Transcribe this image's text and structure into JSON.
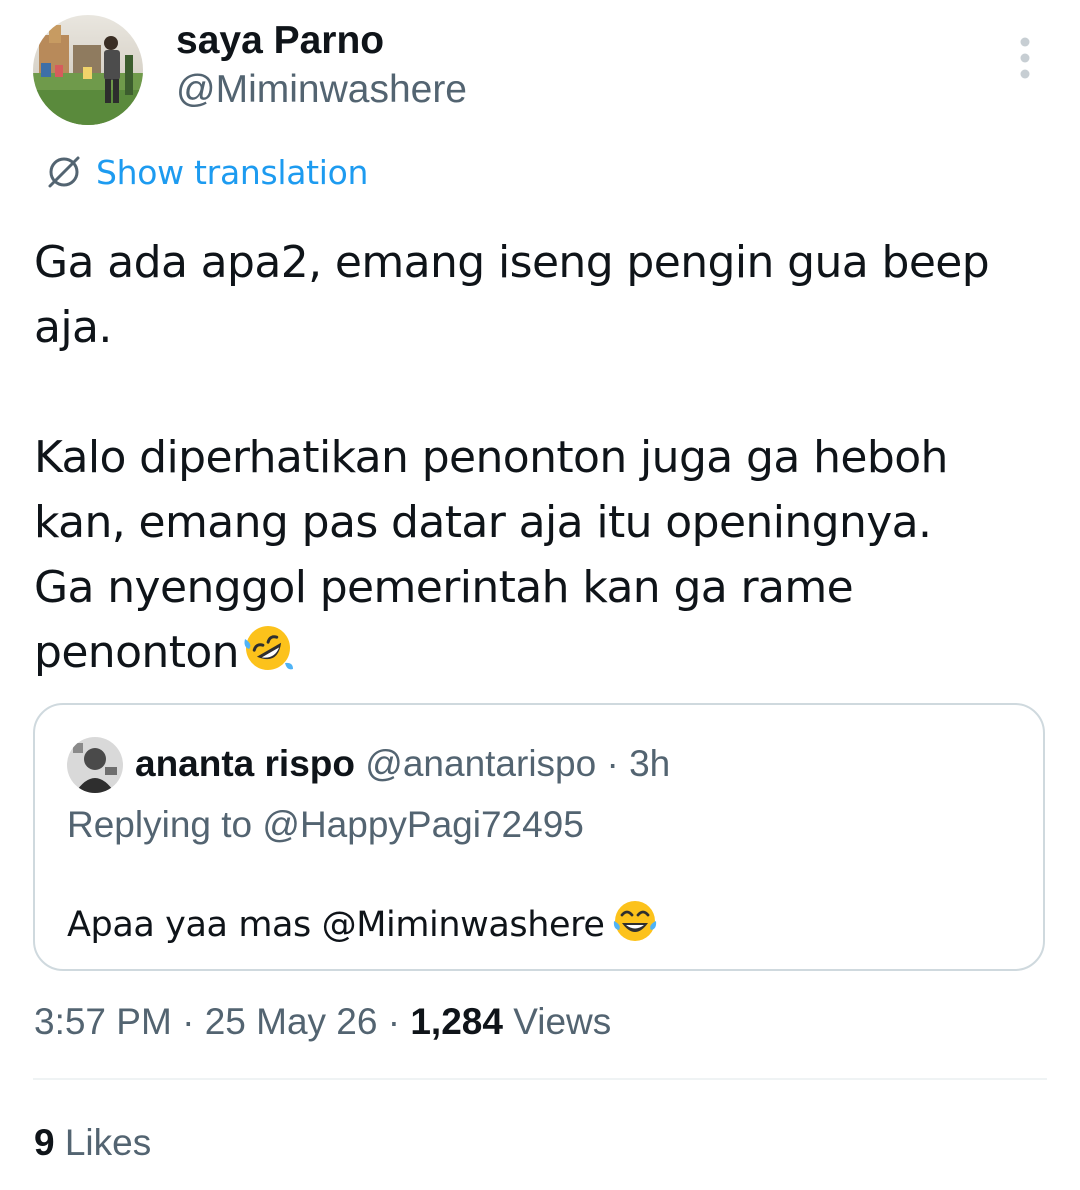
{
  "author": {
    "display_name": "saya Parno",
    "handle": "@Miminwashere"
  },
  "translation": {
    "label": "Show translation",
    "icon": "globe-icon"
  },
  "tweet": {
    "paragraph_1": {
      "line_1": "Ga ada apa2, emang iseng pengin gua beep",
      "line_2": "aja."
    },
    "paragraph_2": {
      "line_1": "Kalo diperhatikan penonton juga ga heboh",
      "line_2": "kan, emang pas datar aja itu openingnya.",
      "line_3": "Ga nyenggol pemerintah kan ga rame",
      "line_4": "penonton",
      "emoji": "rolling-on-floor-laughing"
    }
  },
  "quoted_tweet": {
    "display_name": "ananta rispo",
    "handle": "@anantarispo",
    "separator": "·",
    "time_ago": "3h",
    "replying_prefix": "Replying to",
    "replying_to": "@HappyPagi72495",
    "text_prefix": "Apaa yaa mas",
    "mention": "@Miminwashere",
    "emoji": "face-with-tears-of-joy"
  },
  "meta": {
    "time": "3:57 PM",
    "separator": "·",
    "date": "25 May 26",
    "views_count": "1,284",
    "views_label": "Views"
  },
  "likes": {
    "count": "9",
    "label": "Likes"
  },
  "colors": {
    "link_blue": "#1d9bf0",
    "text_primary": "#0f1419",
    "text_secondary": "#536471",
    "border": "#cfd9de",
    "divider": "#eff3f4"
  }
}
